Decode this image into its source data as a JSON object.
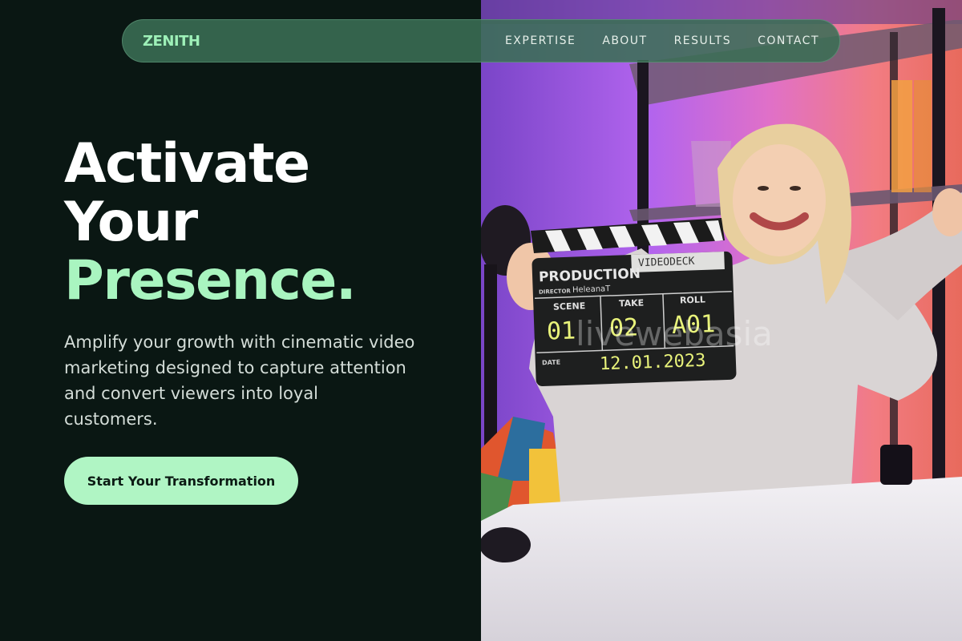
{
  "nav": {
    "logo": "ZENITH",
    "links": [
      "EXPERTISE",
      "ABOUT",
      "RESULTS",
      "CONTACT"
    ]
  },
  "hero": {
    "headline_line1": "Activate",
    "headline_line2": "Your",
    "headline_line3": "Presence.",
    "subtext": "Amplify your growth with cinematic video marketing designed to capture attention and convert viewers into loyal customers.",
    "cta_label": "Start Your Transformation"
  },
  "photo": {
    "clapper_title": "PRODUCTION",
    "clapper_stamp": "VIDEODECK",
    "clapper_director_label": "DIRECTOR",
    "clapper_director": "HeleanaT",
    "clapper_scene_label": "SCENE",
    "clapper_take_label": "TAKE",
    "clapper_roll_label": "ROLL",
    "clapper_scene": "01",
    "clapper_take": "02",
    "clapper_roll": "A01",
    "clapper_date_label": "DATE",
    "clapper_date": "12.01.2023",
    "watermark": "livewebasia"
  },
  "colors": {
    "background": "#0a1713",
    "accent_green": "#a9f5c0",
    "button": "#b0f5c4",
    "nav_bg": "#3a6e54"
  }
}
